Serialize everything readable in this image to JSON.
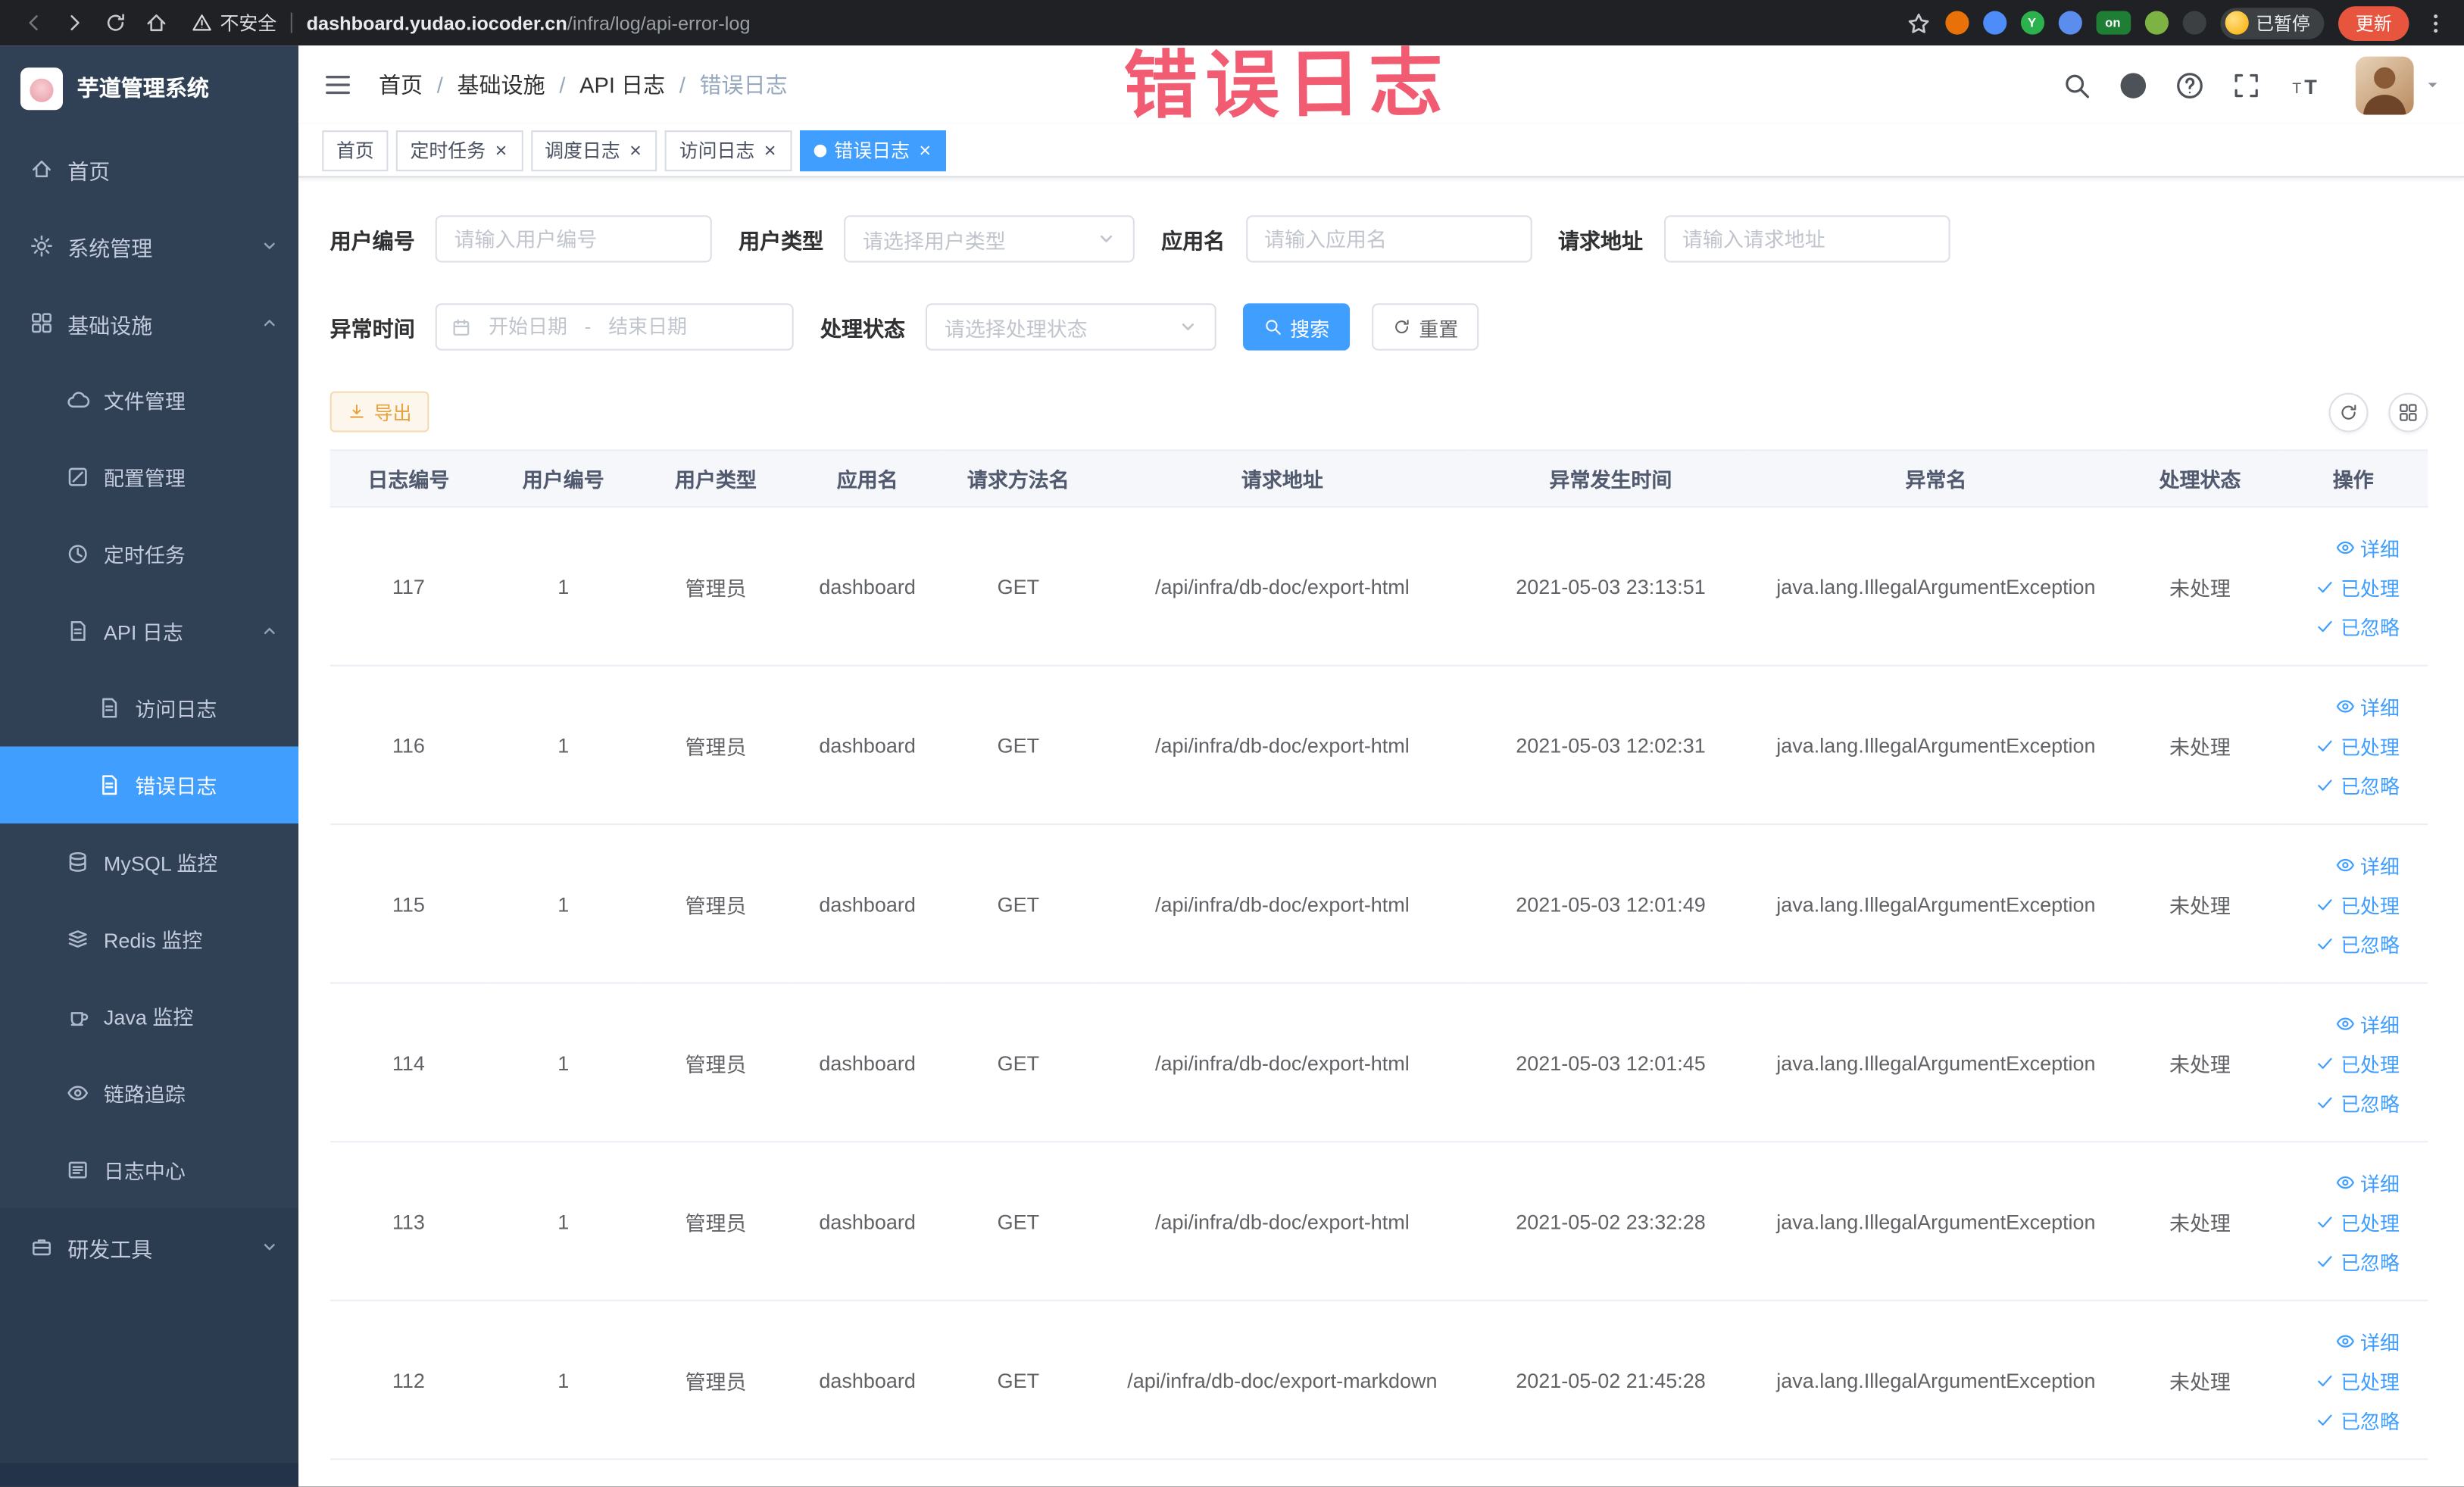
{
  "browser": {
    "security_label": "不安全",
    "url_domain": "dashboard.yudao.iocoder.cn",
    "url_path": "/infra/log/api-error-log",
    "extensions": [
      {
        "name": "extension-orange-icon",
        "color": "#e8710a",
        "label": ""
      },
      {
        "name": "extension-blue-icon",
        "color": "#4e8cf9",
        "label": ""
      },
      {
        "name": "extension-green-circle-icon",
        "color": "#2bb24c",
        "label": "Y"
      },
      {
        "name": "extension-grid-icon",
        "color": "#5b8def",
        "label": ""
      },
      {
        "name": "extension-on-badge-icon",
        "color": "#1e7e34",
        "label": "on"
      },
      {
        "name": "extension-leaf-icon",
        "color": "#7cb342",
        "label": ""
      },
      {
        "name": "extension-paw-icon",
        "color": "#3c4043",
        "label": ""
      }
    ],
    "paused_badge": "已暂停",
    "update_button": "更新"
  },
  "annotation": {
    "text": "错误日志",
    "color": "#f0455e"
  },
  "sidebar": {
    "logo_title": "芋道管理系统",
    "items": [
      {
        "label": "首页",
        "icon": "home-icon",
        "level": 1
      },
      {
        "label": "系统管理",
        "icon": "gear-icon",
        "level": 1,
        "chevron": "down"
      },
      {
        "label": "基础设施",
        "icon": "infrastructure-icon",
        "level": 1,
        "chevron": "up"
      },
      {
        "label": "文件管理",
        "icon": "file-manage-icon",
        "level": 2
      },
      {
        "label": "配置管理",
        "icon": "config-icon",
        "level": 2
      },
      {
        "label": "定时任务",
        "icon": "job-icon",
        "level": 2
      },
      {
        "label": "API 日志",
        "icon": "api-log-icon",
        "level": 2,
        "chevron": "up"
      },
      {
        "label": "访问日志",
        "icon": "access-log-icon",
        "level": 3
      },
      {
        "label": "错误日志",
        "icon": "error-log-icon",
        "level": 3,
        "active": true
      },
      {
        "label": "MySQL 监控",
        "icon": "mysql-icon",
        "level": 2
      },
      {
        "label": "Redis 监控",
        "icon": "redis-icon",
        "level": 2
      },
      {
        "label": "Java 监控",
        "icon": "java-icon",
        "level": 2
      },
      {
        "label": "链路追踪",
        "icon": "trace-icon",
        "level": 2
      },
      {
        "label": "日志中心",
        "icon": "log-center-icon",
        "level": 2
      },
      {
        "label": "研发工具",
        "icon": "tools-icon",
        "level": 1,
        "chevron": "down",
        "dark": true
      }
    ]
  },
  "header": {
    "breadcrumb": [
      "首页",
      "基础设施",
      "API 日志",
      "错误日志"
    ]
  },
  "tabs": [
    {
      "label": "首页",
      "closable": false,
      "active": false
    },
    {
      "label": "定时任务",
      "closable": true,
      "active": false
    },
    {
      "label": "调度日志",
      "closable": true,
      "active": false
    },
    {
      "label": "访问日志",
      "closable": true,
      "active": false
    },
    {
      "label": "错误日志",
      "closable": true,
      "active": true
    }
  ],
  "filters": {
    "user_id": {
      "label": "用户编号",
      "placeholder": "请输入用户编号"
    },
    "user_type": {
      "label": "用户类型",
      "placeholder": "请选择用户类型"
    },
    "app_name": {
      "label": "应用名",
      "placeholder": "请输入应用名"
    },
    "request_url": {
      "label": "请求地址",
      "placeholder": "请输入请求地址"
    },
    "exception_time": {
      "label": "异常时间",
      "start_placeholder": "开始日期",
      "separator": "-",
      "end_placeholder": "结束日期"
    },
    "process_status": {
      "label": "处理状态",
      "placeholder": "请选择处理状态"
    },
    "search_label": "搜索",
    "reset_label": "重置"
  },
  "toolbar": {
    "export_label": "导出"
  },
  "table": {
    "columns": [
      "日志编号",
      "用户编号",
      "用户类型",
      "应用名",
      "请求方法名",
      "请求地址",
      "异常发生时间",
      "异常名",
      "处理状态",
      "操作"
    ],
    "row_actions": [
      "详细",
      "已处理",
      "已忽略"
    ],
    "rows": [
      {
        "log_id": "117",
        "user_id": "1",
        "user_type": "管理员",
        "app_name": "dashboard",
        "method": "GET",
        "url": "/api/infra/db-doc/export-html",
        "time": "2021-05-03 23:13:51",
        "exception": "java.lang.IllegalArgumentException",
        "status": "未处理"
      },
      {
        "log_id": "116",
        "user_id": "1",
        "user_type": "管理员",
        "app_name": "dashboard",
        "method": "GET",
        "url": "/api/infra/db-doc/export-html",
        "time": "2021-05-03 12:02:31",
        "exception": "java.lang.IllegalArgumentException",
        "status": "未处理"
      },
      {
        "log_id": "115",
        "user_id": "1",
        "user_type": "管理员",
        "app_name": "dashboard",
        "method": "GET",
        "url": "/api/infra/db-doc/export-html",
        "time": "2021-05-03 12:01:49",
        "exception": "java.lang.IllegalArgumentException",
        "status": "未处理"
      },
      {
        "log_id": "114",
        "user_id": "1",
        "user_type": "管理员",
        "app_name": "dashboard",
        "method": "GET",
        "url": "/api/infra/db-doc/export-html",
        "time": "2021-05-03 12:01:45",
        "exception": "java.lang.IllegalArgumentException",
        "status": "未处理"
      },
      {
        "log_id": "113",
        "user_id": "1",
        "user_type": "管理员",
        "app_name": "dashboard",
        "method": "GET",
        "url": "/api/infra/db-doc/export-html",
        "time": "2021-05-02 23:32:28",
        "exception": "java.lang.IllegalArgumentException",
        "status": "未处理"
      },
      {
        "log_id": "112",
        "user_id": "1",
        "user_type": "管理员",
        "app_name": "dashboard",
        "method": "GET",
        "url": "/api/infra/db-doc/export-markdown",
        "time": "2021-05-02 21:45:28",
        "exception": "java.lang.IllegalArgumentException",
        "status": "未处理"
      }
    ]
  },
  "colors": {
    "accent": "#409eff",
    "sidebar_bg": "#304156",
    "warning": "#e6a23c"
  }
}
